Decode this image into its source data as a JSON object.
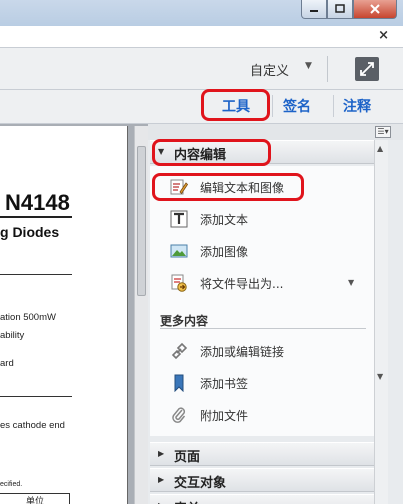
{
  "window": {
    "minimize": "—",
    "maximize": "□",
    "close": "✕"
  },
  "doc_close": "×",
  "toolbar": {
    "custom_label": "自定义",
    "custom_arrow": "▼"
  },
  "tabs": {
    "tools": "工具",
    "sign": "签名",
    "comment": "注释"
  },
  "document": {
    "title": "N4148",
    "subtitle": "g Diodes",
    "lines": [
      "ation 500mW",
      "ability",
      "ard",
      "es cathode end"
    ],
    "tiny": "ecified.",
    "table_cell": "单位"
  },
  "panel": {
    "content_edit": {
      "header": "内容编辑",
      "items": [
        {
          "label": "编辑文本和图像",
          "icon": "edit-text-image-icon"
        },
        {
          "label": "添加文本",
          "icon": "add-text-icon"
        },
        {
          "label": "添加图像",
          "icon": "add-image-icon"
        },
        {
          "label": "将文件导出为...",
          "icon": "export-file-icon",
          "has_dropdown": true
        }
      ],
      "more_title": "更多内容",
      "more_items": [
        {
          "label": "添加或编辑链接",
          "icon": "link-icon"
        },
        {
          "label": "添加书签",
          "icon": "bookmark-icon"
        },
        {
          "label": "附加文件",
          "icon": "paperclip-icon"
        }
      ]
    },
    "sections": [
      "页面",
      "交互对象",
      "表单"
    ]
  },
  "colors": {
    "highlight": "#e0141c",
    "tab_text": "#1d63c8"
  }
}
